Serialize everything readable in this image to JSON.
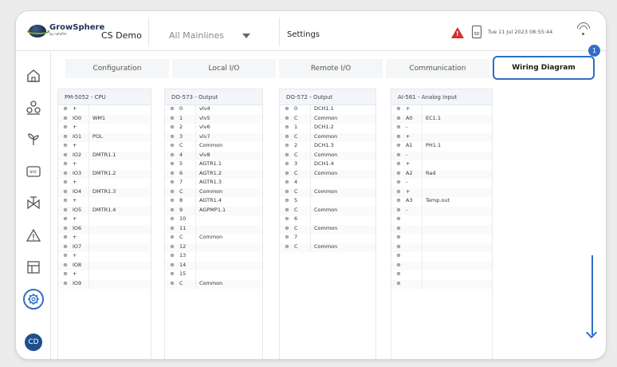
{
  "header": {
    "brand_name": "GrowSphere",
    "brand_subline": "by netafim",
    "site_name": "CS Demo",
    "mainline_select": "All Mainlines",
    "settings_label": "Settings",
    "sd_label": "SD",
    "datetime": "Tue 11 Jul 2023  08:55:44"
  },
  "sidebar": {
    "items": [
      "home-icon",
      "plants-icon",
      "sprout-icon",
      "controller-icon",
      "valve-icon",
      "alert-icon",
      "table-icon",
      "gear-icon"
    ],
    "avatar": "CD"
  },
  "tabs": [
    {
      "label": "Configuration"
    },
    {
      "label": "Local I/O"
    },
    {
      "label": "Remote I/O"
    },
    {
      "label": "Communication"
    },
    {
      "label": "Wiring Diagram",
      "active": true
    }
  ],
  "callout_number": "1",
  "modules": [
    {
      "title": "PM-5052 - CPU",
      "rows": [
        [
          "⊕",
          "+",
          ""
        ],
        [
          "⊕",
          "IO0",
          "WM1"
        ],
        [
          "⊕",
          "+",
          ""
        ],
        [
          "⊕",
          "IO1",
          "POL"
        ],
        [
          "⊕",
          "+",
          ""
        ],
        [
          "⊕",
          "IO2",
          "DMTR1.1"
        ],
        [
          "⊕",
          "+",
          ""
        ],
        [
          "⊕",
          "IO3",
          "DMTR1.2"
        ],
        [
          "⊕",
          "+",
          ""
        ],
        [
          "⊕",
          "IO4",
          "DMTR1.3"
        ],
        [
          "⊕",
          "+",
          ""
        ],
        [
          "⊕",
          "IO5",
          "DMTR1.4"
        ],
        [
          "⊕",
          "+",
          ""
        ],
        [
          "⊕",
          "IO6",
          ""
        ],
        [
          "⊕",
          "+",
          ""
        ],
        [
          "⊕",
          "IO7",
          ""
        ],
        [
          "⊕",
          "+",
          ""
        ],
        [
          "⊕",
          "IO8",
          ""
        ],
        [
          "⊕",
          "+",
          ""
        ],
        [
          "⊕",
          "IO9",
          ""
        ]
      ]
    },
    {
      "title": "DO-573 - Output",
      "rows": [
        [
          "⊕",
          "0",
          "vlv4"
        ],
        [
          "⊕",
          "1",
          "vlv5"
        ],
        [
          "⊕",
          "2",
          "vlv6"
        ],
        [
          "⊕",
          "3",
          "vlv7"
        ],
        [
          "⊕",
          "C",
          "Common"
        ],
        [
          "⊕",
          "4",
          "vlv8"
        ],
        [
          "⊕",
          "5",
          "AGTR1.1"
        ],
        [
          "⊕",
          "6",
          "AGTR1.2"
        ],
        [
          "⊕",
          "7",
          "AGTR1.3"
        ],
        [
          "⊕",
          "C",
          "Common"
        ],
        [
          "⊕",
          "8",
          "AGTR1.4"
        ],
        [
          "⊕",
          "9",
          "AGPMP1.1"
        ],
        [
          "⊕",
          "10",
          ""
        ],
        [
          "⊕",
          "11",
          ""
        ],
        [
          "⊕",
          "C",
          "Common"
        ],
        [
          "⊕",
          "12",
          ""
        ],
        [
          "⊕",
          "13",
          ""
        ],
        [
          "⊕",
          "14",
          ""
        ],
        [
          "⊕",
          "15",
          ""
        ],
        [
          "⊕",
          "C",
          "Common"
        ]
      ]
    },
    {
      "title": "DO-572 - Output",
      "rows": [
        [
          "⊕",
          "0",
          "DCH1.1"
        ],
        [
          "⊕",
          "C",
          "Common"
        ],
        [
          "⊕",
          "1",
          "DCH1.2"
        ],
        [
          "⊕",
          "C",
          "Common"
        ],
        [
          "⊕",
          "2",
          "DCH1.3"
        ],
        [
          "⊕",
          "C",
          "Common"
        ],
        [
          "⊕",
          "3",
          "DCH1.4"
        ],
        [
          "⊕",
          "C",
          "Common"
        ],
        [
          "⊕",
          "4",
          ""
        ],
        [
          "⊕",
          "C",
          "Common"
        ],
        [
          "⊕",
          "5",
          ""
        ],
        [
          "⊕",
          "C",
          "Common"
        ],
        [
          "⊕",
          "6",
          ""
        ],
        [
          "⊕",
          "C",
          "Common"
        ],
        [
          "⊕",
          "7",
          ""
        ],
        [
          "⊕",
          "C",
          "Common"
        ]
      ]
    },
    {
      "title": "AI-561 - Analog Input",
      "rows": [
        [
          "⊕",
          "+",
          ""
        ],
        [
          "⊕",
          "A0",
          "EC1.1"
        ],
        [
          "⊕",
          "-",
          ""
        ],
        [
          "⊕",
          "+",
          ""
        ],
        [
          "⊕",
          "A1",
          "PH1.1"
        ],
        [
          "⊕",
          "-",
          ""
        ],
        [
          "⊕",
          "+",
          ""
        ],
        [
          "⊕",
          "A2",
          "Rad"
        ],
        [
          "⊕",
          "-",
          ""
        ],
        [
          "⊕",
          "+",
          ""
        ],
        [
          "⊕",
          "A3",
          "Temp.out"
        ],
        [
          "⊕",
          "-",
          ""
        ],
        [
          "⊕",
          "",
          ""
        ],
        [
          "⊕",
          "",
          ""
        ],
        [
          "⊕",
          "",
          ""
        ],
        [
          "⊕",
          "",
          ""
        ],
        [
          "⊕",
          "",
          ""
        ],
        [
          "⊕",
          "",
          ""
        ],
        [
          "⊕",
          "",
          ""
        ],
        [
          "⊕",
          "",
          ""
        ]
      ]
    }
  ]
}
